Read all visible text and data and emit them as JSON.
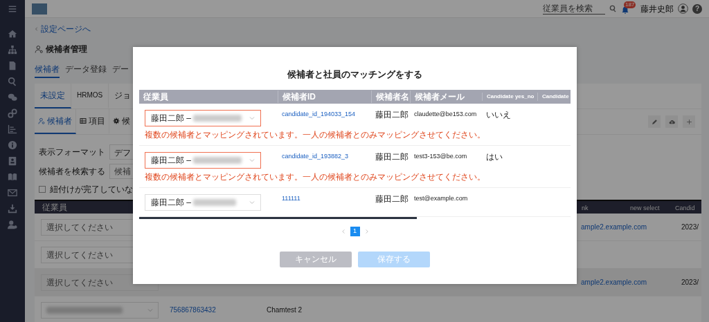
{
  "topbar": {
    "search": {
      "placeholder": "従業員を検索"
    },
    "notification_count": "187",
    "user_name": "藤井史郎",
    "help": "?"
  },
  "back_link": "設定ページへ",
  "page_title": "候補者管理",
  "tabs": [
    {
      "label": "候補者",
      "selected": true
    },
    {
      "label": "データ登録",
      "selected": false
    },
    {
      "label": "デー",
      "selected": false
    }
  ],
  "source_tabs": [
    {
      "label": "未設定",
      "selected": true
    },
    {
      "label": "HRMOS",
      "selected": false
    },
    {
      "label": "ジョ",
      "selected": false
    }
  ],
  "view_tabs": [
    {
      "label": "候補者",
      "selected": true
    },
    {
      "label": "項目",
      "selected": false
    },
    {
      "label": "候",
      "selected": false
    }
  ],
  "filters": {
    "format_label": "表示フォーマット",
    "format_value": "デフ",
    "search_label": "候補者を検索する",
    "search_placeholder": "候補",
    "checkbox": {
      "label": "紐付けが完了していな",
      "checked": false
    }
  },
  "table": {
    "columns": [
      "従業員",
      "nk",
      "new select",
      "Candid"
    ],
    "rows": [
      {
        "employee_placeholder": "選択してください",
        "link": "ample2.example.com",
        "date": "2023/"
      },
      {
        "employee_placeholder": "選択してください"
      },
      {
        "employee_placeholder": "選択してください",
        "link": "ample2.example.com",
        "date": "2023/"
      },
      {
        "employee_redacted": true,
        "candidate_id": "756867863432",
        "candidate_name": "Chamtest 2"
      }
    ]
  },
  "modal": {
    "title": "候補者と社員のマッチングをする",
    "columns": [
      "従業員",
      "候補者ID",
      "候補者名",
      "候補者メール",
      "Candidate yes_no",
      "Candidate"
    ],
    "rows": [
      {
        "employee": "藤田二郎 –",
        "error": "複数の候補者とマッピングされています。一人の候補者とのみマッピングさせてください。",
        "candidate_id": "candidate_id_194033_154",
        "name": "藤田二郎",
        "email": "claudette@be153.com",
        "yes_no": "いいえ"
      },
      {
        "employee": "藤田二郎 –",
        "error": "複数の候補者とマッピングされています。一人の候補者とのみマッピングさせてください。",
        "candidate_id": "candidate_id_193882_3",
        "name": "藤田二郎",
        "email": "test3-153@be.com",
        "yes_no": "はい"
      },
      {
        "employee": "藤田二郎 –",
        "candidate_id": "111111",
        "name": "藤田二郎",
        "email": "test@example.com"
      }
    ],
    "pages": [
      {
        "label": "1",
        "selected": true
      }
    ],
    "cancel": {
      "label": "キャンセル"
    },
    "save": {
      "label": "保存する",
      "disabled": true
    }
  }
}
